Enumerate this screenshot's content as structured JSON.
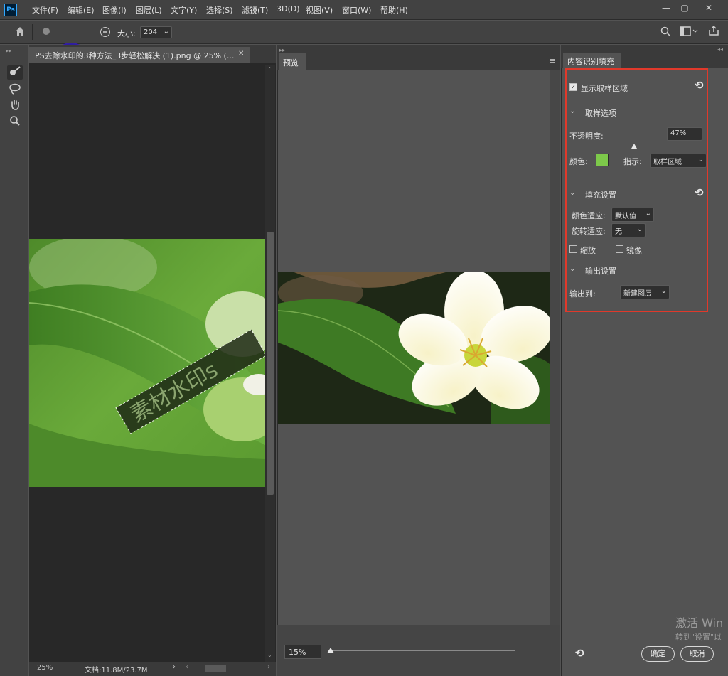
{
  "app": {
    "logo": "Ps",
    "menus": [
      "文件(F)",
      "编辑(E)",
      "图像(I)",
      "图层(L)",
      "文字(Y)",
      "选择(S)",
      "滤镜(T)",
      "3D(D)",
      "视图(V)",
      "窗口(W)",
      "帮助(H)"
    ],
    "window_controls": [
      "—",
      "▢",
      "✕"
    ]
  },
  "options_bar": {
    "size_label": "大小:",
    "size_value": "204"
  },
  "document": {
    "tab_title": "PS去除水印的3种方法_3步轻松解决 (1).png @ 25% (...",
    "tab_close": "✕",
    "watermark_text": "素材水印s",
    "status_zoom": "25%",
    "status_doc": "文档:11.8M/23.7M"
  },
  "preview": {
    "tab_label": "预览",
    "zoom_value": "15%",
    "zoom_level": 0.0
  },
  "content_aware_fill": {
    "panel_title": "内容识别填充",
    "show_sampling_area": "显示取样区域",
    "show_sampling_checked": true,
    "sampling_options_header": "取样选项",
    "opacity_label": "不透明度:",
    "opacity_value": "47%",
    "opacity_fraction": 0.47,
    "color_label": "颜色:",
    "color_swatch": "#7dc94a",
    "indicate_label": "指示:",
    "indicate_value": "取样区域",
    "fill_settings_header": "填充设置",
    "color_adapt_label": "颜色适应:",
    "color_adapt_value": "默认值",
    "rotation_adapt_label": "旋转适应:",
    "rotation_adapt_value": "无",
    "scale_label": "缩放",
    "scale_checked": false,
    "mirror_label": "镜像",
    "mirror_checked": false,
    "output_settings_header": "输出设置",
    "output_to_label": "输出到:",
    "output_to_value": "新建图层",
    "ok_label": "确定",
    "cancel_label": "取消",
    "highlight_color": "#e0392b"
  },
  "os_watermark": {
    "line1": "激活 Win",
    "line2": "转到\"设置\"以"
  }
}
